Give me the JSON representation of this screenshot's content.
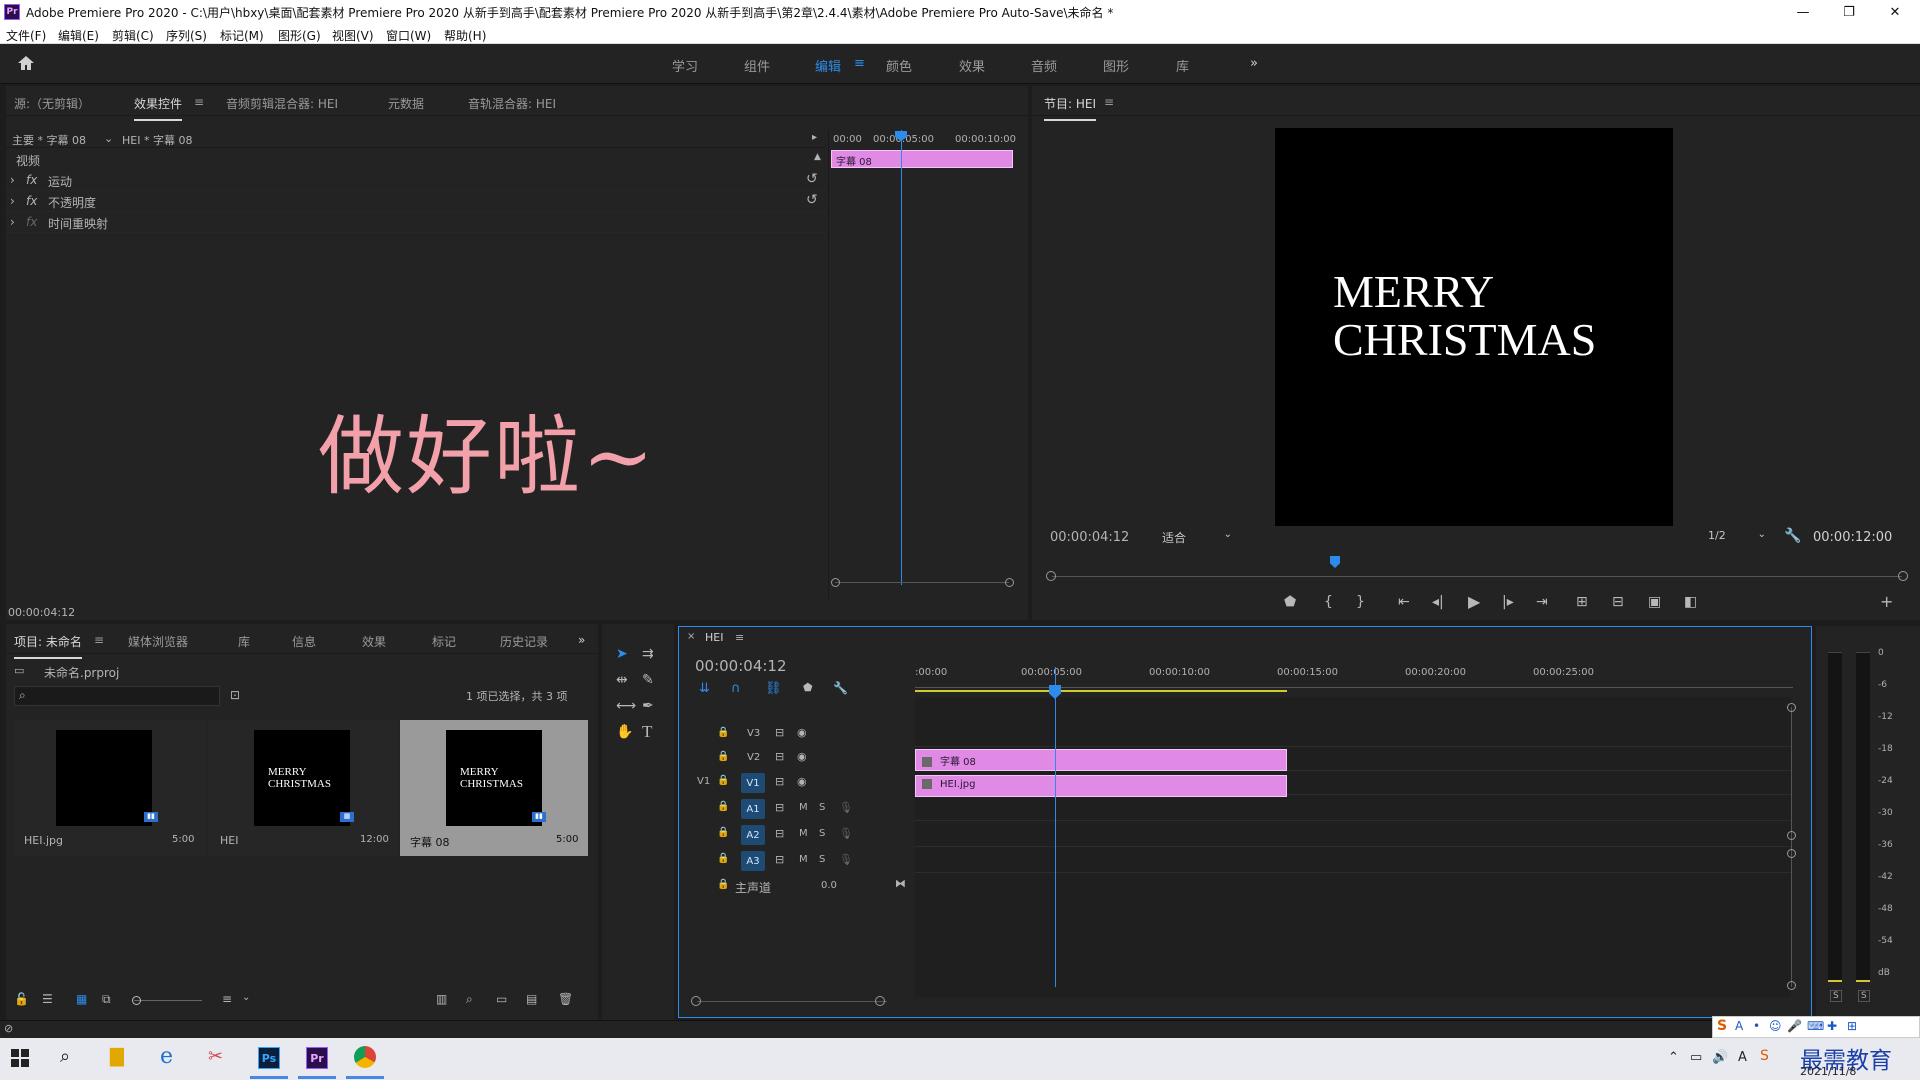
{
  "window": {
    "title": "Adobe Premiere Pro 2020 - C:\\用户\\hbxy\\桌面\\配套素材 Premiere Pro 2020 从新手到高手\\配套素材 Premiere Pro 2020 从新手到高手\\第2章\\2.4.4\\素材\\Adobe Premiere Pro Auto-Save\\未命名 *",
    "logo": "Pr",
    "controls": [
      "—",
      "❐",
      "✕"
    ]
  },
  "menu": [
    "文件(F)",
    "编辑(E)",
    "剪辑(C)",
    "序列(S)",
    "标记(M)",
    "图形(G)",
    "视图(V)",
    "窗口(W)",
    "帮助(H)"
  ],
  "workspaces": {
    "items": [
      "学习",
      "组件",
      "编辑",
      "颜色",
      "效果",
      "音频",
      "图形",
      "库"
    ],
    "active": "编辑",
    "more": "»"
  },
  "source_panel": {
    "tabs": [
      "源:（无剪辑）",
      "效果控件",
      "音频剪辑混合器: HEI",
      "元数据",
      "音轨混合器: HEI"
    ],
    "active_tab": "效果控件",
    "breadcrumb_master": "主要 * 字幕 08",
    "breadcrumb_seq": "HEI * 字幕 08",
    "ruler": [
      "00:00",
      "00:00:05:00",
      "00:00:10:00"
    ],
    "clip_label": "字幕 08",
    "section_video": "视频",
    "effects": [
      "运动",
      "不透明度",
      "时间重映射"
    ],
    "fx_symbol": "fx",
    "overlay_text": "做好啦~",
    "timecode": "00:00:04:12"
  },
  "program_monitor": {
    "title": "节目: HEI",
    "frame_text_line1": "MERRY",
    "frame_text_line2": "CHRISTMAS",
    "timecode": "00:00:04:12",
    "fit": "适合",
    "quality": "1/2",
    "duration": "00:00:12:00"
  },
  "project_panel": {
    "tabs": [
      "项目: 未命名",
      "媒体浏览器",
      "库",
      "信息",
      "效果",
      "标记",
      "历史记录"
    ],
    "active_tab": "项目: 未命名",
    "file": "未命名.prproj",
    "selection_status": "1 项已选择，共 3 项",
    "items": [
      {
        "name": "HEI.jpg",
        "duration": "5:00",
        "text1": "",
        "text2": ""
      },
      {
        "name": "HEI",
        "duration": "12:00",
        "text1": "MERRY",
        "text2": "CHRISTMAS"
      },
      {
        "name": "字幕 08",
        "duration": "5:00",
        "text1": "MERRY",
        "text2": "CHRISTMAS"
      }
    ]
  },
  "timeline": {
    "tab": "HEI",
    "timecode": "00:00:04:12",
    "ruler": [
      ":00:00",
      "00:00:05:00",
      "00:00:10:00",
      "00:00:15:00",
      "00:00:20:00",
      "00:00:25:00"
    ],
    "video_tracks": [
      "V3",
      "V2",
      "V1"
    ],
    "audio_tracks": [
      "A1",
      "A2",
      "A3"
    ],
    "source_patch_v": "V1",
    "clips": [
      {
        "track": "V2",
        "label": "字幕 08"
      },
      {
        "track": "V1",
        "label": "HEI.jpg"
      }
    ],
    "master_label": "主声道",
    "master_value": "0.0",
    "mute": "M",
    "solo": "S"
  },
  "audio_meter": {
    "scale": [
      "0",
      "-6",
      "-12",
      "-18",
      "-24",
      "-30",
      "-36",
      "-42",
      "-48",
      "-54",
      "dB"
    ],
    "solo_labels": [
      "S",
      "S"
    ]
  },
  "taskbar": {
    "date": "2021/11/8",
    "watermark": "最需教育"
  }
}
